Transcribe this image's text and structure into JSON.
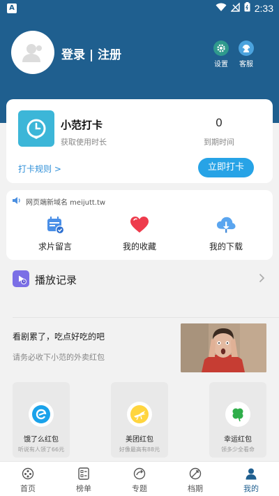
{
  "status_bar": {
    "carrier_badge": "A",
    "time": "2:33"
  },
  "profile": {
    "login_label": "登录 | 注册"
  },
  "top_actions": [
    {
      "label": "设置",
      "icon": "gear-icon"
    },
    {
      "label": "客服",
      "icon": "customer-service-icon"
    }
  ],
  "checkin": {
    "title": "小范打卡",
    "subtitle": "获取使用时长",
    "count": "0",
    "count_label": "到期时间",
    "rules_link": "打卡规则 >",
    "button": "立即打卡"
  },
  "notice": "网页端新域名 meijutt.tw",
  "features": [
    {
      "label": "求片留言",
      "icon": "calendar-icon"
    },
    {
      "label": "我的收藏",
      "icon": "heart-icon"
    },
    {
      "label": "我的下载",
      "icon": "cloud-download-icon"
    }
  ],
  "history": {
    "label": "播放记录"
  },
  "promo": {
    "title": "看剧累了，吃点好吃的吧",
    "subtitle": "请务必收下小范的外卖红包"
  },
  "coupons": [
    {
      "name": "饿了么红包",
      "tip": "听说有人领了66元",
      "icon": "eleme-icon"
    },
    {
      "name": "美团红包",
      "tip": "好像最高有88元",
      "icon": "meituan-icon"
    },
    {
      "name": "幸运红包",
      "tip": "领多少全看命",
      "icon": "clover-icon"
    }
  ],
  "nav": [
    {
      "label": "首页",
      "icon": "home-icon"
    },
    {
      "label": "榜单",
      "icon": "rank-icon"
    },
    {
      "label": "专题",
      "icon": "topic-icon"
    },
    {
      "label": "档期",
      "icon": "schedule-icon"
    },
    {
      "label": "我的",
      "icon": "profile-icon",
      "active": true
    }
  ],
  "colors": {
    "header": "#1f5f8f",
    "accent": "#27a3e6",
    "link": "#2e8fd8"
  }
}
